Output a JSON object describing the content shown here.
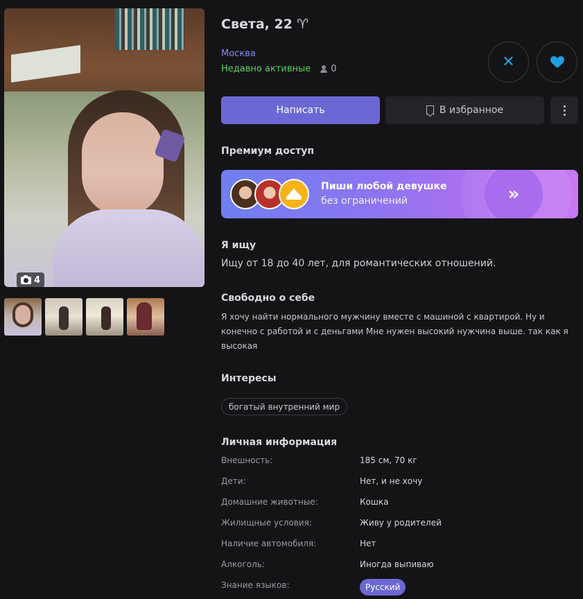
{
  "profile": {
    "name_age": "Света, 22",
    "zodiac_glyph": "♈",
    "city": "Москва",
    "status": "Недавно активные",
    "views": "0",
    "photo_count": "4"
  },
  "actions": {
    "write_label": "Написать",
    "favorite_label": "В избранное"
  },
  "premium": {
    "section_title": "Премиум доступ",
    "banner_title": "Пиши любой девушке",
    "banner_subtitle": "без ограничений",
    "arrow_glyph": "»"
  },
  "looking_for": {
    "title": "Я ищу",
    "text": "Ищу от 18 до 40 лет, для романтических отношений."
  },
  "about": {
    "title": "Свободно о себе",
    "text": "Я хочу найти нормального мужчину вместе с машиной с квартирой. Ну и конечно с работой и с деньгами Мне нужен высокий нужчина выше. так как я высокая"
  },
  "interests": {
    "title": "Интересы",
    "items": [
      "богатый внутренний мир"
    ]
  },
  "personal_info": {
    "title": "Личная информация",
    "rows": [
      {
        "label": "Внешность:",
        "value": "185 см, 70 кг"
      },
      {
        "label": "Дети:",
        "value": "Нет, и не хочу"
      },
      {
        "label": "Домашние животные:",
        "value": "Кошка"
      },
      {
        "label": "Жилищные условия:",
        "value": "Живу у родителей"
      },
      {
        "label": "Наличие автомобиля:",
        "value": "Нет"
      },
      {
        "label": "Алкоголь:",
        "value": "Иногда выпиваю"
      },
      {
        "label": "Знание языков:",
        "value": "Русский"
      }
    ]
  },
  "icons": {
    "camera": "camera-icon",
    "person": "person-icon",
    "close": "close-icon",
    "heart": "heart-icon",
    "bookmark": "bookmark-icon",
    "more": "more-vertical-icon",
    "crown": "crown-icon",
    "arrows": "double-chevron-right-icon"
  },
  "colors": {
    "background": "#141416",
    "accent": "#6b68d6",
    "city": "#8a8cf0",
    "online": "#5fd05f",
    "action_blue": "#1ea0e0",
    "crown_gold": "#f6b41a"
  }
}
